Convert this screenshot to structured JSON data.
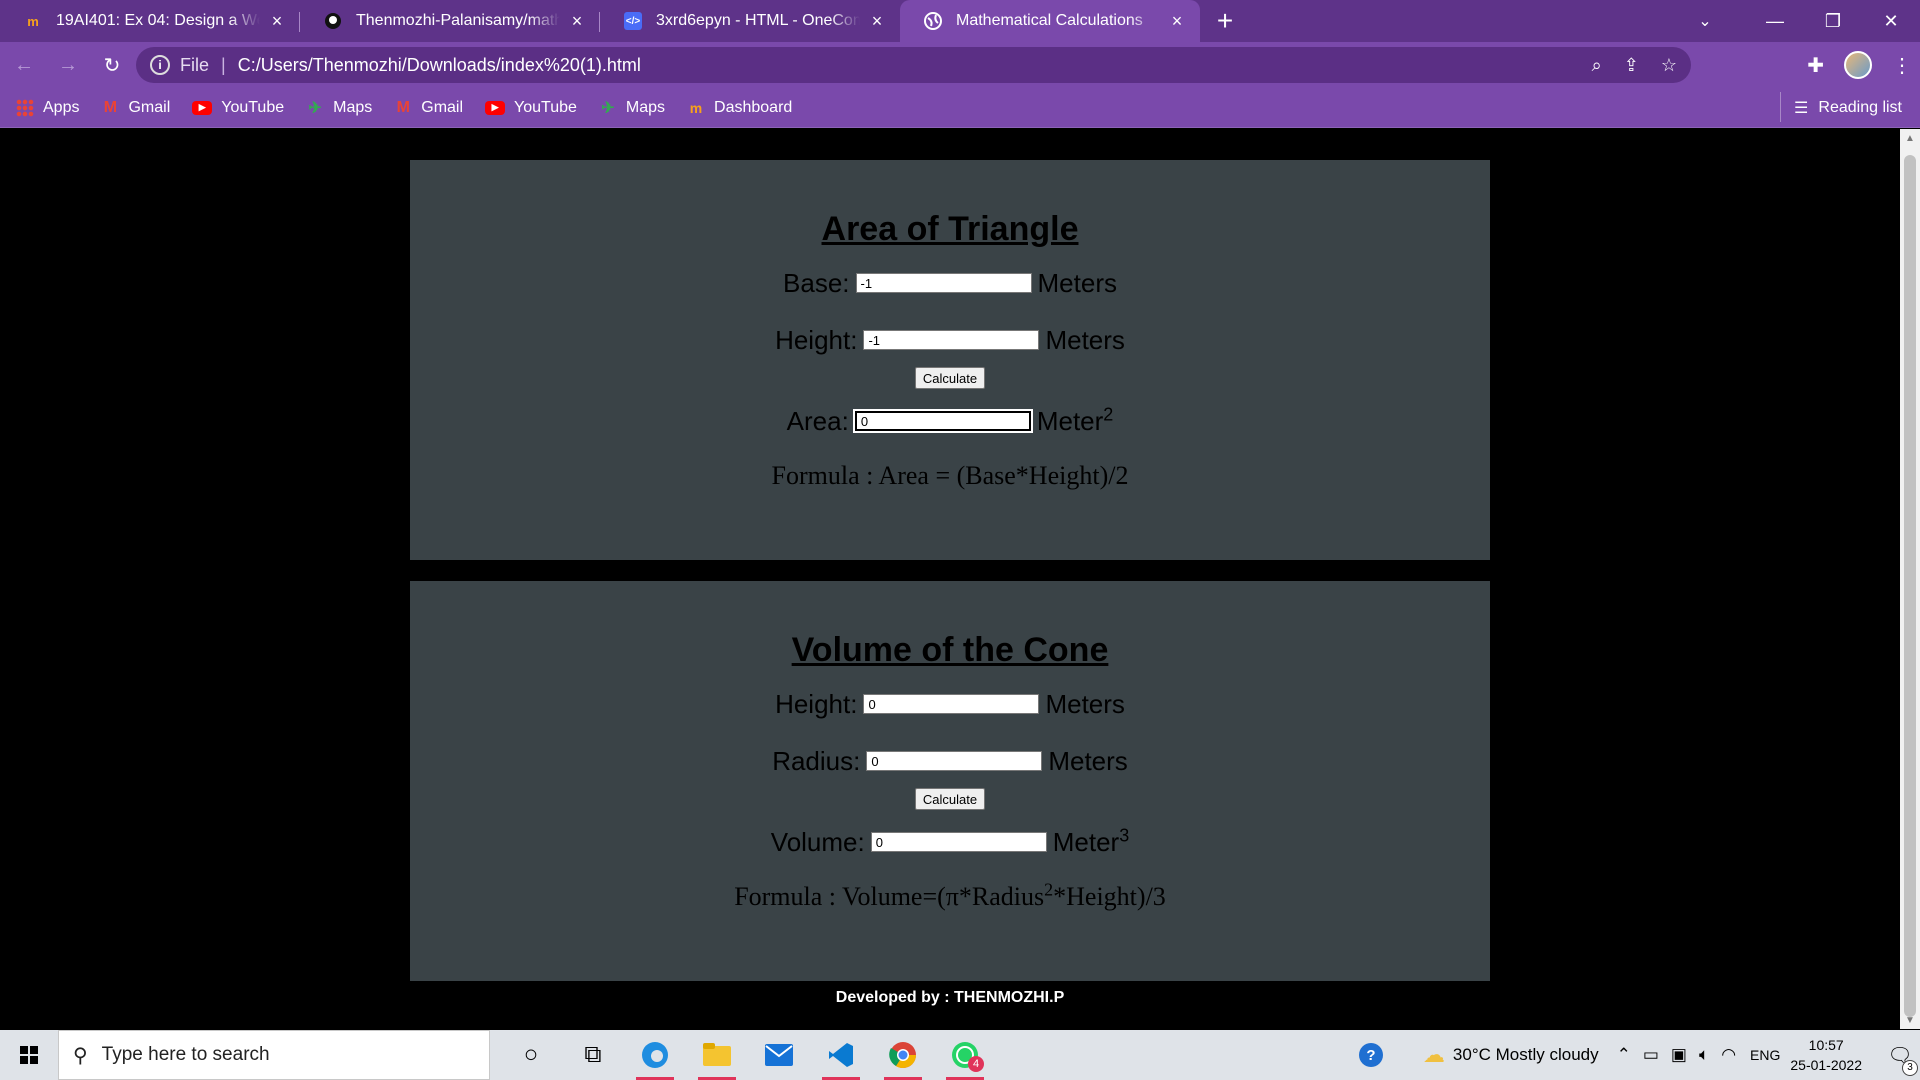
{
  "browser": {
    "tabs": [
      {
        "title": "19AI401: Ex 04: Design a Website",
        "icon": "moodle-icon"
      },
      {
        "title": "Thenmozhi-Palanisamy/mathweb",
        "icon": "github-icon"
      },
      {
        "title": "3xrd6epyn - HTML - OneCompiler",
        "icon": "onecompiler-icon"
      },
      {
        "title": "Mathematical Calculations",
        "icon": "globe-icon"
      }
    ],
    "address": {
      "scheme": "File",
      "url": "C:/Users/Thenmozhi/Downloads/index%20(1).html"
    },
    "bookmarks": [
      {
        "label": "Apps",
        "icon": "apps-grid-icon"
      },
      {
        "label": "Gmail",
        "icon": "gmail-icon"
      },
      {
        "label": "YouTube",
        "icon": "youtube-icon"
      },
      {
        "label": "Maps",
        "icon": "maps-icon"
      },
      {
        "label": "Gmail",
        "icon": "gmail-icon"
      },
      {
        "label": "YouTube",
        "icon": "youtube-icon"
      },
      {
        "label": "Maps",
        "icon": "maps-icon"
      },
      {
        "label": "Dashboard",
        "icon": "moodle-icon"
      }
    ],
    "reading_list": "Reading list",
    "colors": {
      "frame": "#5e3389",
      "toolbar": "#7a49ab"
    }
  },
  "page": {
    "triangle": {
      "heading": "Area of Triangle",
      "base_label": "Base:",
      "base_value": "-1",
      "height_label": "Height:",
      "height_value": "-1",
      "unit": "Meters",
      "button": "Calculate",
      "area_label": "Area:",
      "area_value": "0",
      "area_unit": "Meter",
      "area_exp": "2",
      "formula": "Formula : Area = (Base*Height)/2"
    },
    "cone": {
      "heading": "Volume of the Cone",
      "height_label": "Height:",
      "height_value": "0",
      "radius_label": "Radius:",
      "radius_value": "0",
      "unit": "Meters",
      "button": "Calculate",
      "volume_label": "Volume:",
      "volume_value": "0",
      "volume_unit": "Meter",
      "volume_exp": "3",
      "formula_pre": "Formula : Volume=(π*Radius",
      "formula_exp": "2",
      "formula_post": "*Height)/3"
    },
    "footer": "Developed by : THENMOZHI.P",
    "colors": {
      "panel": "#3a4347",
      "background": "#000000"
    }
  },
  "taskbar": {
    "search_placeholder": "Type here to search",
    "weather": "30°C  Mostly cloudy",
    "lang": "ENG",
    "time": "10:57",
    "date": "25-01-2022",
    "notification_count": "3",
    "whatsapp_badge": "4"
  }
}
